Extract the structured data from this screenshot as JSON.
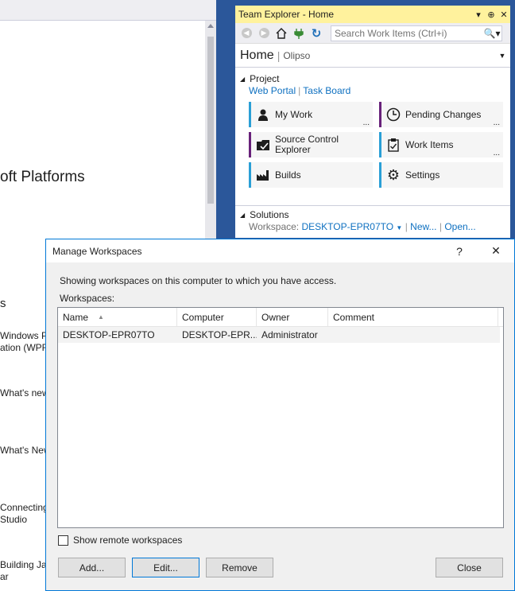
{
  "start_page": {
    "heading": "oft Platforms",
    "section_title": "s",
    "items": [
      "Windows Pr",
      "ation (WPF",
      "What's new",
      "What's New",
      "Connecting",
      "Studio",
      "Building Jav",
      "ar"
    ]
  },
  "team_explorer": {
    "title": "Team Explorer - Home",
    "title_controls": [
      "▾",
      "⊕",
      "✕"
    ],
    "search": {
      "placeholder": "Search Work Items (Ctrl+i)"
    },
    "home": {
      "title": "Home",
      "project": "Olipso"
    },
    "project_section": {
      "title": "Project",
      "links": [
        "Web Portal",
        "Task Board"
      ]
    },
    "tiles": [
      {
        "label": "My Work",
        "icon": "person-icon",
        "glyph": "👤",
        "more": "...",
        "accent": "#2a9fd6"
      },
      {
        "label": "Pending Changes",
        "icon": "clock-icon",
        "glyph": "🕓",
        "more": "...",
        "accent": "#68217a"
      },
      {
        "label": "Source Control Explorer",
        "icon": "source-control-icon",
        "glyph": "🗂",
        "more": "",
        "accent": "#68217a"
      },
      {
        "label": "Work Items",
        "icon": "work-items-icon",
        "glyph": "📋",
        "more": "...",
        "accent": "#2a9fd6"
      },
      {
        "label": "Builds",
        "icon": "builds-icon",
        "glyph": "🏭",
        "more": "",
        "accent": "#2a9fd6"
      },
      {
        "label": "Settings",
        "icon": "settings-icon",
        "glyph": "⚙",
        "more": "",
        "accent": "#2a9fd6"
      }
    ],
    "solutions_section": {
      "title": "Solutions",
      "workspace_label": "Workspace:",
      "workspace_value": "DESKTOP-EPR07TO",
      "new_link": "New...",
      "open_link": "Open..."
    }
  },
  "dialog": {
    "title": "Manage Workspaces",
    "help": "?",
    "close": "✕",
    "description": "Showing workspaces on this computer to which you have access.",
    "workspaces_label": "Workspaces:",
    "columns": [
      "Name",
      "Computer",
      "Owner",
      "Comment"
    ],
    "rows": [
      {
        "name": "DESKTOP-EPR07TO",
        "computer": "DESKTOP-EPR...",
        "owner": "Administrator",
        "comment": ""
      }
    ],
    "show_remote": {
      "label": "Show remote workspaces",
      "checked": false
    },
    "buttons": {
      "add": "Add...",
      "edit": "Edit...",
      "remove": "Remove",
      "close": "Close"
    }
  }
}
